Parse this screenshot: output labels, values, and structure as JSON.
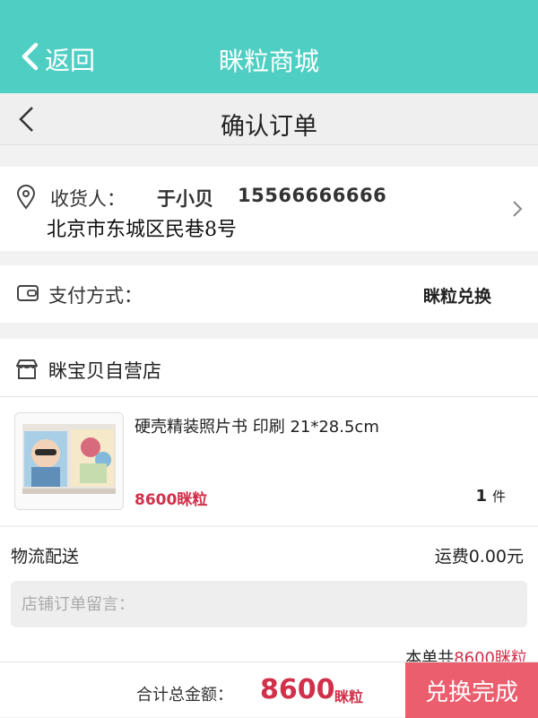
{
  "topbar": {
    "back_label": "返回",
    "title": "眯粒商城"
  },
  "subheader": {
    "title": "确认订单"
  },
  "address": {
    "recipient_label": "收货人：",
    "recipient_name": "于小贝",
    "phone": "15566666666",
    "address_line": "北京市东城区民巷8号"
  },
  "payment": {
    "label": "支付方式：",
    "value": "眯粒兑换"
  },
  "shop": {
    "name": "眯宝贝自营店",
    "product": {
      "name": "硬壳精装照片书 印刷 21*28.5cm",
      "price": "8600眯粒",
      "qty": "1",
      "qty_unit": "件"
    }
  },
  "delivery": {
    "label": "物流配送",
    "fee": "运费0.00元",
    "message_placeholder": "店铺订单留言：",
    "subtotal_prefix": "本单共",
    "subtotal_amount": "8600",
    "subtotal_unit": "眯粒"
  },
  "footer": {
    "total_label": "合计总金额：",
    "total_amount": "8600",
    "total_unit": "眯粒",
    "submit_label": "兑换完成"
  },
  "colors": {
    "topbar": "#4fcfc3",
    "accent_red": "#d0304a",
    "submit_button": "#ea5e6e"
  }
}
